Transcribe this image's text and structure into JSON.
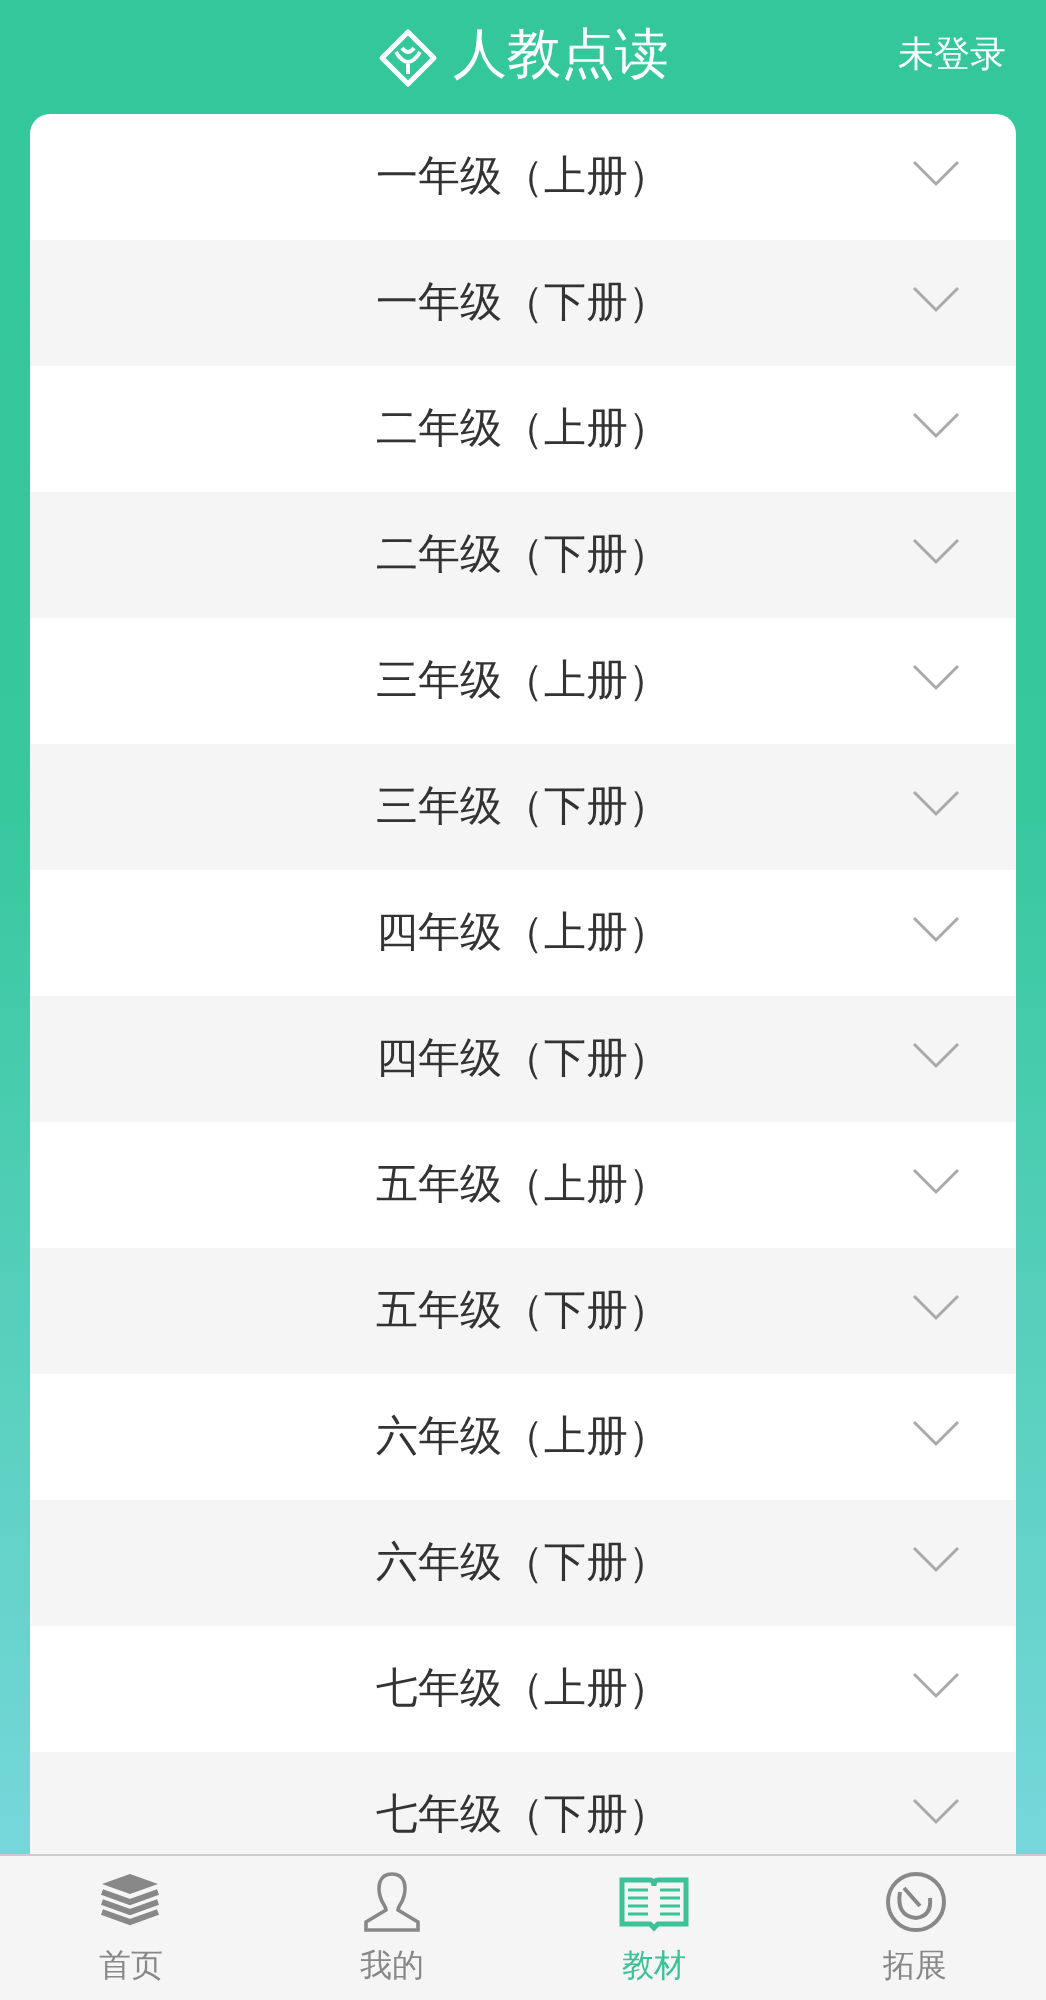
{
  "header": {
    "title": "人教点读",
    "login": "未登录"
  },
  "grades": [
    {
      "label": "一年级（上册）",
      "expanded": false
    },
    {
      "label": "一年级（下册）",
      "expanded": false
    },
    {
      "label": "二年级（上册）",
      "expanded": false
    },
    {
      "label": "二年级（下册）",
      "expanded": false
    },
    {
      "label": "三年级（上册）",
      "expanded": false
    },
    {
      "label": "三年级（下册）",
      "expanded": false
    },
    {
      "label": "四年级（上册）",
      "expanded": false
    },
    {
      "label": "四年级（下册）",
      "expanded": false
    },
    {
      "label": "五年级（上册）",
      "expanded": false
    },
    {
      "label": "五年级（下册）",
      "expanded": false
    },
    {
      "label": "六年级（上册）",
      "expanded": false
    },
    {
      "label": "六年级（下册）",
      "expanded": false
    },
    {
      "label": "七年级（上册）",
      "expanded": false
    },
    {
      "label": "七年级（下册）",
      "expanded": false
    }
  ],
  "tabs": [
    {
      "label": "首页",
      "kind": "books",
      "selected": false
    },
    {
      "label": "我的",
      "kind": "person",
      "selected": false
    },
    {
      "label": "教材",
      "kind": "book",
      "selected": true
    },
    {
      "label": "拓展",
      "kind": "dial",
      "selected": false
    }
  ]
}
